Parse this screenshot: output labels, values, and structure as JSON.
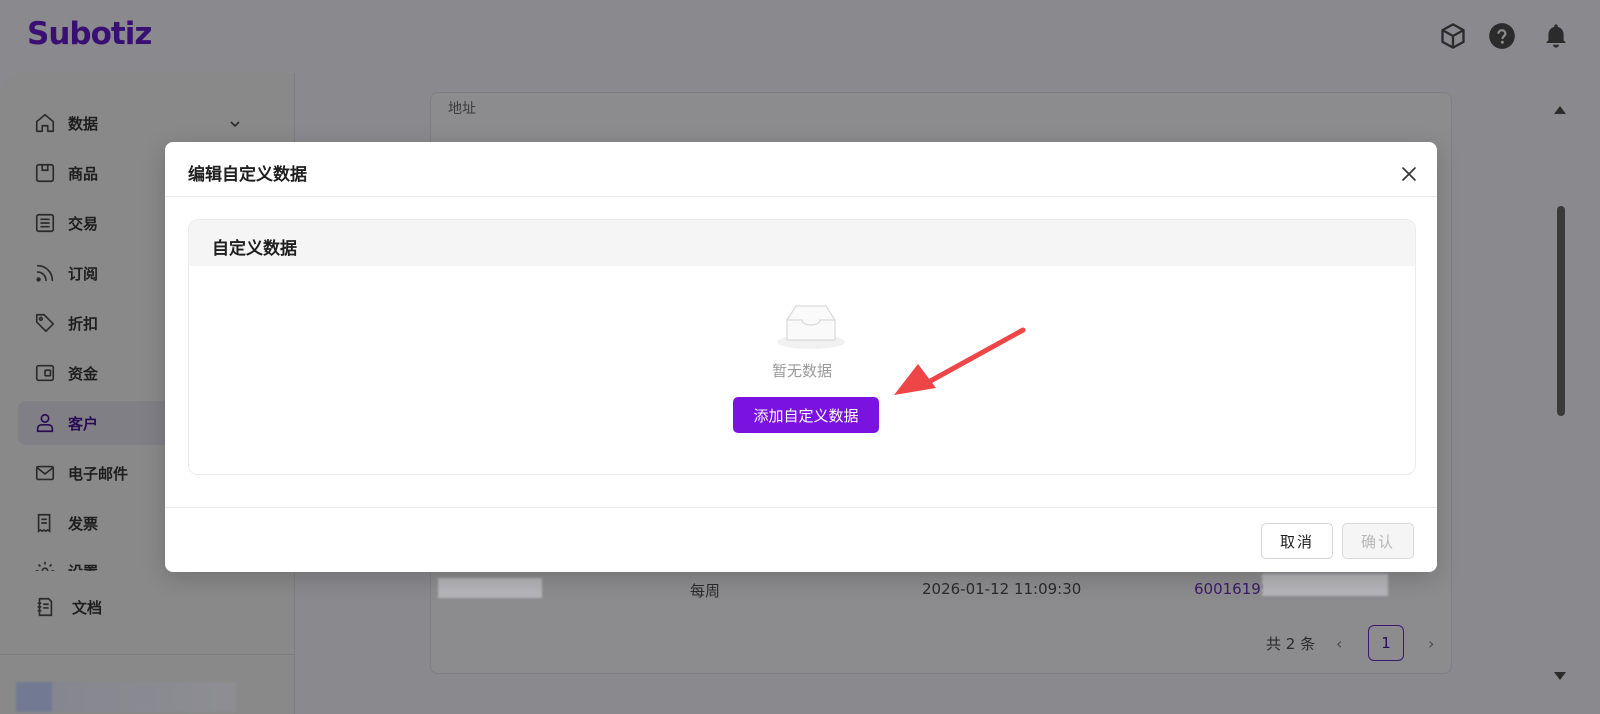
{
  "app": {
    "logo": "Subotiz",
    "colors": {
      "brand": "#7a12e0",
      "annotation_arrow": "#ee4646"
    },
    "top_icons": [
      "cube-icon",
      "help-icon",
      "bell-icon"
    ]
  },
  "sidebar": {
    "items": [
      {
        "label": "数据",
        "icon": "home-icon",
        "has_chevron": true
      },
      {
        "label": "商品",
        "icon": "box-icon"
      },
      {
        "label": "交易",
        "icon": "list-icon"
      },
      {
        "label": "订阅",
        "icon": "rss-icon"
      },
      {
        "label": "折扣",
        "icon": "tag-icon"
      },
      {
        "label": "资金",
        "icon": "wallet-icon"
      },
      {
        "label": "客户",
        "icon": "user-icon",
        "active": true
      },
      {
        "label": "电子邮件",
        "icon": "mail-icon"
      },
      {
        "label": "发票",
        "icon": "receipt-icon"
      },
      {
        "label": "设置",
        "icon": "settings-icon"
      }
    ],
    "docs_label": "文档"
  },
  "background": {
    "address_label": "地址",
    "row": {
      "frequency": "每周",
      "datetime": "2026-01-12 11:09:30",
      "id": "60016199"
    },
    "pagination": {
      "total": "共 2 条",
      "page": "1",
      "prev": "‹",
      "next": "›"
    }
  },
  "modal": {
    "title": "编辑自定义数据",
    "section_title": "自定义数据",
    "empty_text": "暂无数据",
    "add_button": "添加自定义数据",
    "cancel_button": "取消",
    "confirm_button": "确认"
  }
}
